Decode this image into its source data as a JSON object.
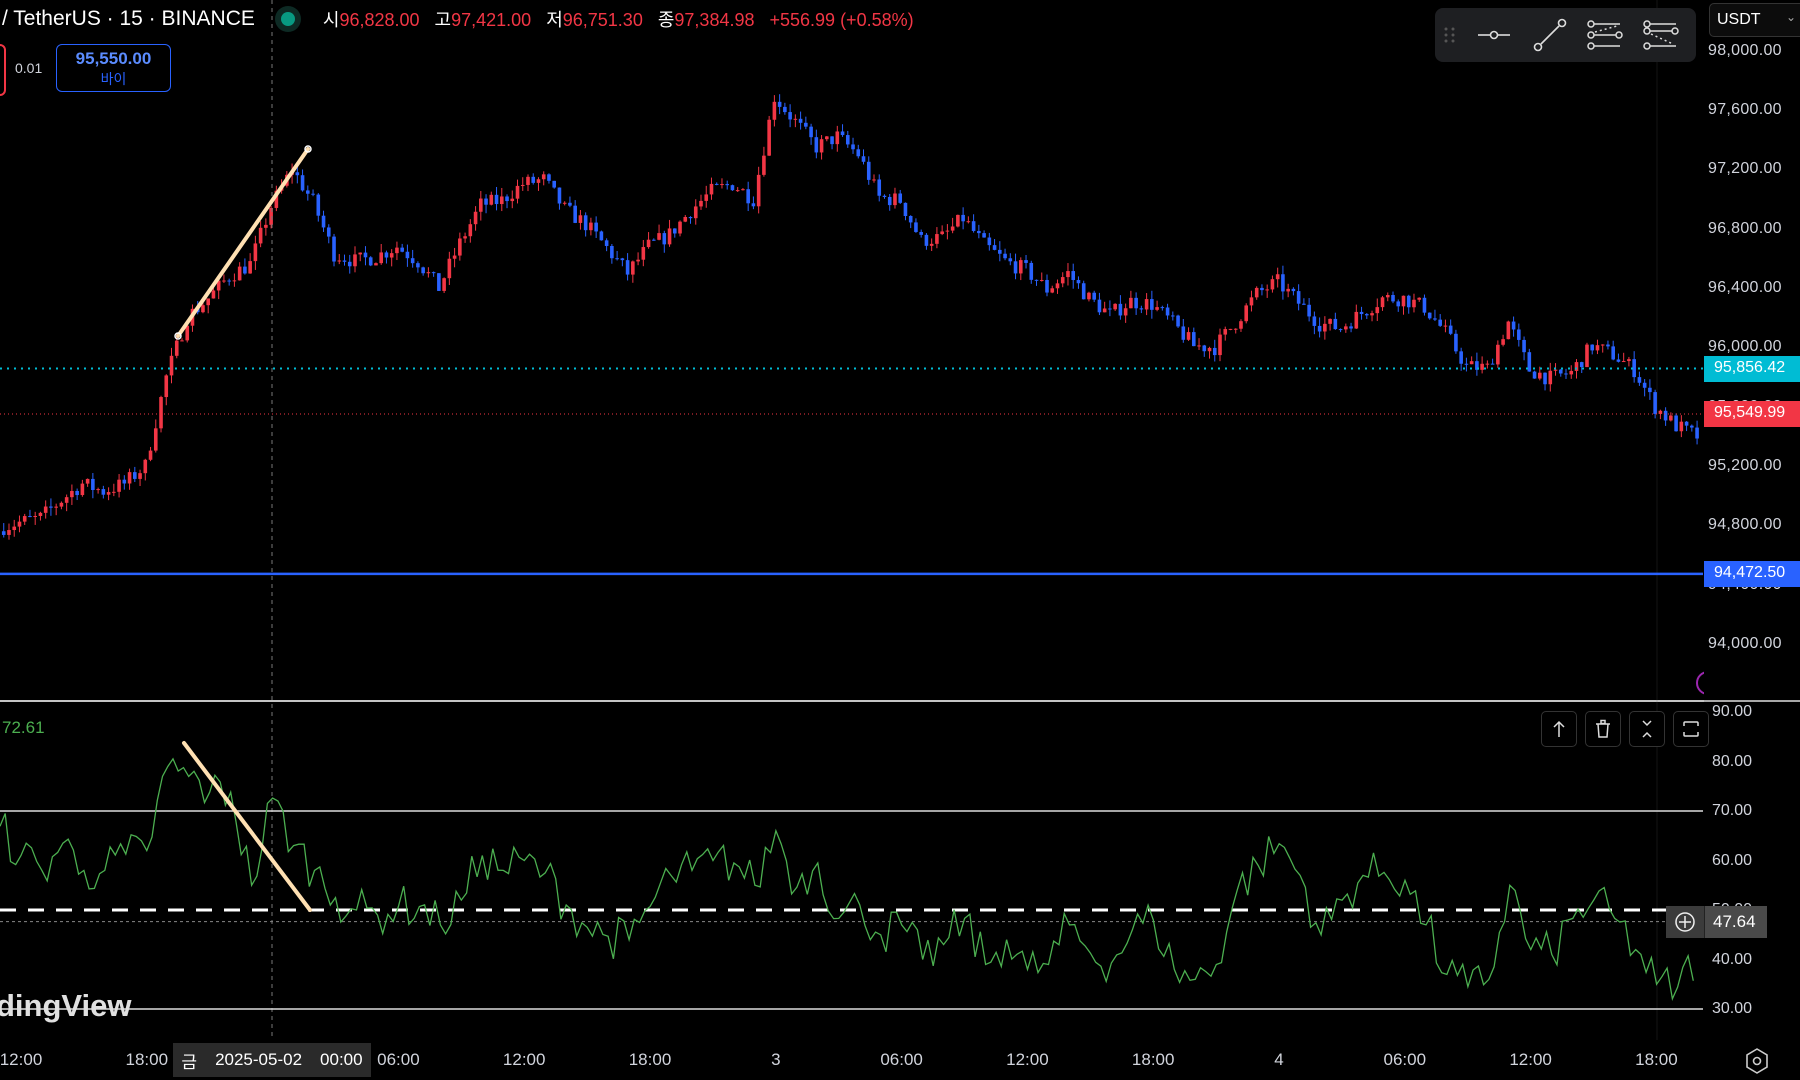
{
  "header": {
    "symbol": "/ TetherUS · 15 · BINANCE",
    "open_label": "시",
    "open": "96,828.00",
    "high_label": "고",
    "high": "97,421.00",
    "low_label": "저",
    "low": "96,751.30",
    "close_label": "종",
    "close": "97,384.98",
    "change": "+556.99 (+0.58%)",
    "market_status_color": "#089981"
  },
  "order": {
    "quantity": "0.01",
    "buy_price": "95,550.00",
    "buy_label": "바이"
  },
  "toolbar": {
    "icons": [
      "drag-handle-icon",
      "horizontal-line-icon",
      "trend-line-icon",
      "fib-retracement-icon",
      "fib-extension-icon"
    ]
  },
  "currency": {
    "selected": "USDT"
  },
  "price_axis": {
    "labels": [
      "98,000.00",
      "97,600.00",
      "97,200.00",
      "96,800.00",
      "96,400.00",
      "96,000.00",
      "95,600.00",
      "95,200.00",
      "94,800.00",
      "94,400.00",
      "94,000.00"
    ],
    "values": [
      98000,
      97600,
      97200,
      96800,
      96400,
      96000,
      95600,
      95200,
      94800,
      94400,
      94000
    ]
  },
  "price_lines": [
    {
      "label": "95,856.42",
      "value": 95856.42,
      "color": "#00bcd4",
      "style": "dotted"
    },
    {
      "label": "95,549.99",
      "value": 95549.99,
      "color": "#f23645",
      "style": "dotted"
    },
    {
      "label": "94,472.50",
      "value": 94472.5,
      "color": "#2962ff",
      "style": "solid"
    }
  ],
  "rsi": {
    "current_label": "72.61",
    "axis_labels": [
      "90.00",
      "80.00",
      "70.00",
      "60.00",
      "50.00",
      "40.00",
      "30.00"
    ],
    "axis_values": [
      90,
      80,
      70,
      60,
      50,
      40,
      30
    ],
    "bands": {
      "upper": 70,
      "middle": 50,
      "lower": 30
    },
    "value_tag": "47.64",
    "value": 47.64,
    "line_color": "#4caf50",
    "pane_buttons": [
      "move-up-icon",
      "delete-icon",
      "collapse-icon",
      "maximize-icon"
    ]
  },
  "watermark": "dingView",
  "time_axis": {
    "labels": [
      "12:00",
      "18:00",
      "06:00",
      "12:00",
      "18:00",
      "3",
      "06:00",
      "12:00",
      "18:00",
      "4",
      "06:00",
      "12:00",
      "18:00"
    ],
    "crosshair_day": "금",
    "crosshair_date": "2025-05-02",
    "crosshair_time": "00:00"
  },
  "chart_data": {
    "type": "candlestick",
    "interval": "15",
    "start": "2025-05-01 11:00",
    "up_color": "#f23645",
    "down_color": "#2962ff",
    "hourly_close": [
      94780,
      94820,
      94850,
      94970,
      95080,
      95030,
      95080,
      95200,
      95800,
      96200,
      96330,
      96480,
      96560,
      96950,
      97200,
      96980,
      96630,
      96580,
      96610,
      96680,
      96580,
      96400,
      96700,
      96960,
      96990,
      97100,
      97130,
      96930,
      96830,
      96670,
      96500,
      96680,
      96760,
      96920,
      97050,
      97100,
      97000,
      97690,
      97520,
      97350,
      97420,
      97300,
      97010,
      96990,
      96720,
      96740,
      96870,
      96690,
      96580,
      96520,
      96390,
      96500,
      96330,
      96220,
      96310,
      96290,
      96160,
      96010,
      96000,
      96170,
      96360,
      96440,
      96300,
      96160,
      96130,
      96230,
      96330,
      96330,
      96270,
      96100,
      95870,
      95860,
      96170,
      95850,
      95790,
      95830,
      96010,
      95950,
      95850,
      95600,
      95470,
      95400
    ],
    "rsi_hourly": [
      66.9,
      61,
      58,
      63.5,
      58,
      58,
      61.3,
      62,
      79,
      77,
      73.8,
      73.8,
      55,
      72.6,
      63,
      58,
      52.5,
      50,
      49,
      50.7,
      50.7,
      47,
      52,
      61,
      58,
      60,
      57.5,
      51,
      46.5,
      44.7,
      44,
      50.7,
      57,
      58,
      60,
      59.5,
      55,
      66,
      54.6,
      59.5,
      48.3,
      51,
      45,
      47,
      40,
      43,
      48.3,
      39,
      44,
      38,
      39,
      47,
      41.3,
      39.3,
      46,
      48,
      38,
      36,
      39,
      54,
      59,
      63.4,
      57,
      45,
      52,
      57,
      57.6,
      56,
      47,
      37,
      34.5,
      36,
      55,
      42,
      41,
      48.3,
      52,
      48.3,
      42,
      35,
      34.4,
      41.3
    ],
    "drawings": [
      {
        "type": "trend-line",
        "pane": "price",
        "from": {
          "time": "2025-05-01 19:30",
          "price": 96080
        },
        "to": {
          "time": "2025-05-02 01:45",
          "price": 97340
        },
        "color": "#ffe0b2"
      },
      {
        "type": "trend-line",
        "pane": "rsi",
        "from": {
          "time": "2025-05-01 19:45",
          "value": 84
        },
        "to": {
          "time": "2025-05-02 01:45",
          "value": 50
        },
        "color": "#ffe0b2"
      }
    ]
  }
}
